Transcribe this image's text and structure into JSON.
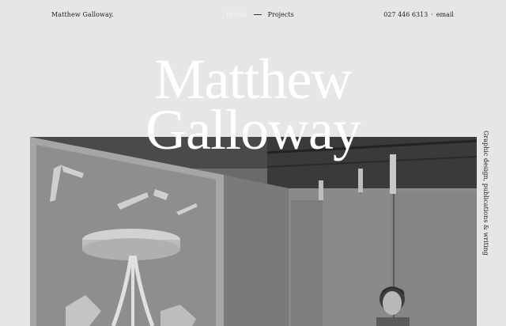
{
  "header": {
    "brand": "Matthew Galloway.",
    "nav": {
      "current": "Profile",
      "link": "Projects"
    },
    "phone": "027 446 6313",
    "separator": "·",
    "email": "email"
  },
  "hero": {
    "line1": "Matthew",
    "line2": "Galloway"
  },
  "tagline": "Graphic design, publications & writing"
}
